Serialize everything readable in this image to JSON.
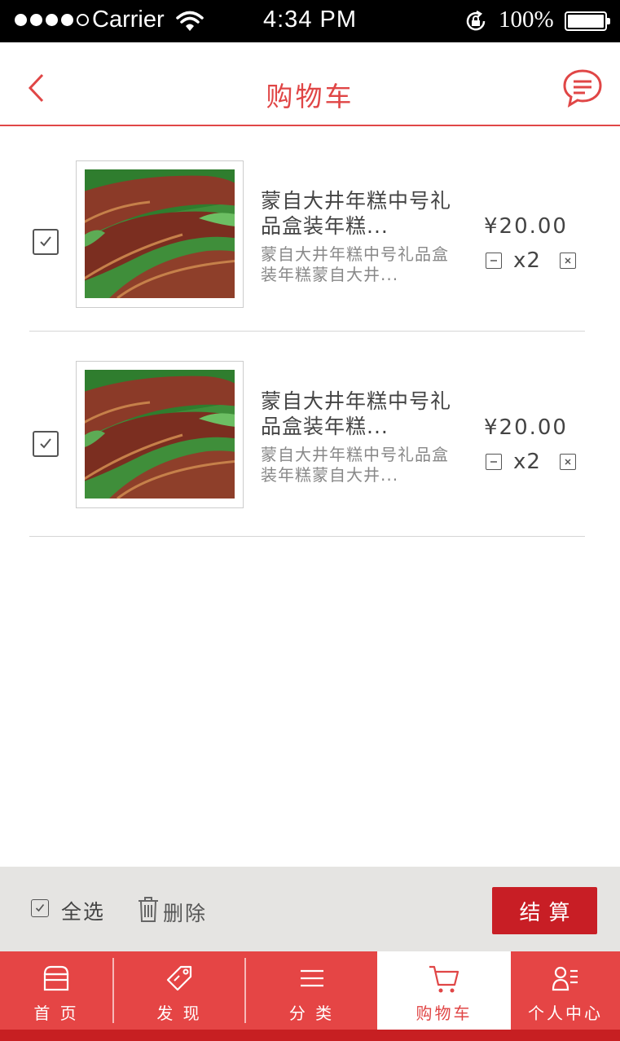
{
  "status_bar": {
    "carrier": "Carrier",
    "time": "4:34 PM",
    "battery": "100%"
  },
  "header": {
    "title": "购物车"
  },
  "cart": {
    "items": [
      {
        "name": "蒙自大井年糕中号礼品盒装年糕...",
        "desc": "蒙自大井年糕中号礼品盒装年糕蒙自大井...",
        "price": "¥20.00",
        "qty": "x2",
        "checked": true
      },
      {
        "name": "蒙自大井年糕中号礼品盒装年糕...",
        "desc": "蒙自大井年糕中号礼品盒装年糕蒙自大井...",
        "price": "¥20.00",
        "qty": "x2",
        "checked": true
      }
    ]
  },
  "action_bar": {
    "select_all": "全选",
    "delete": "删除",
    "checkout": "结算"
  },
  "tabs": [
    {
      "label": "首 页",
      "icon": "store-icon",
      "active": false
    },
    {
      "label": "发 现",
      "icon": "tag-icon",
      "active": false
    },
    {
      "label": "分 类",
      "icon": "list-icon",
      "active": false
    },
    {
      "label": "购物车",
      "icon": "cart-icon",
      "active": true
    },
    {
      "label": "个人中心",
      "icon": "user-icon",
      "active": false
    }
  ],
  "colors": {
    "accent": "#e04646",
    "checkout": "#c81e25",
    "tabbar": "#e54545"
  }
}
